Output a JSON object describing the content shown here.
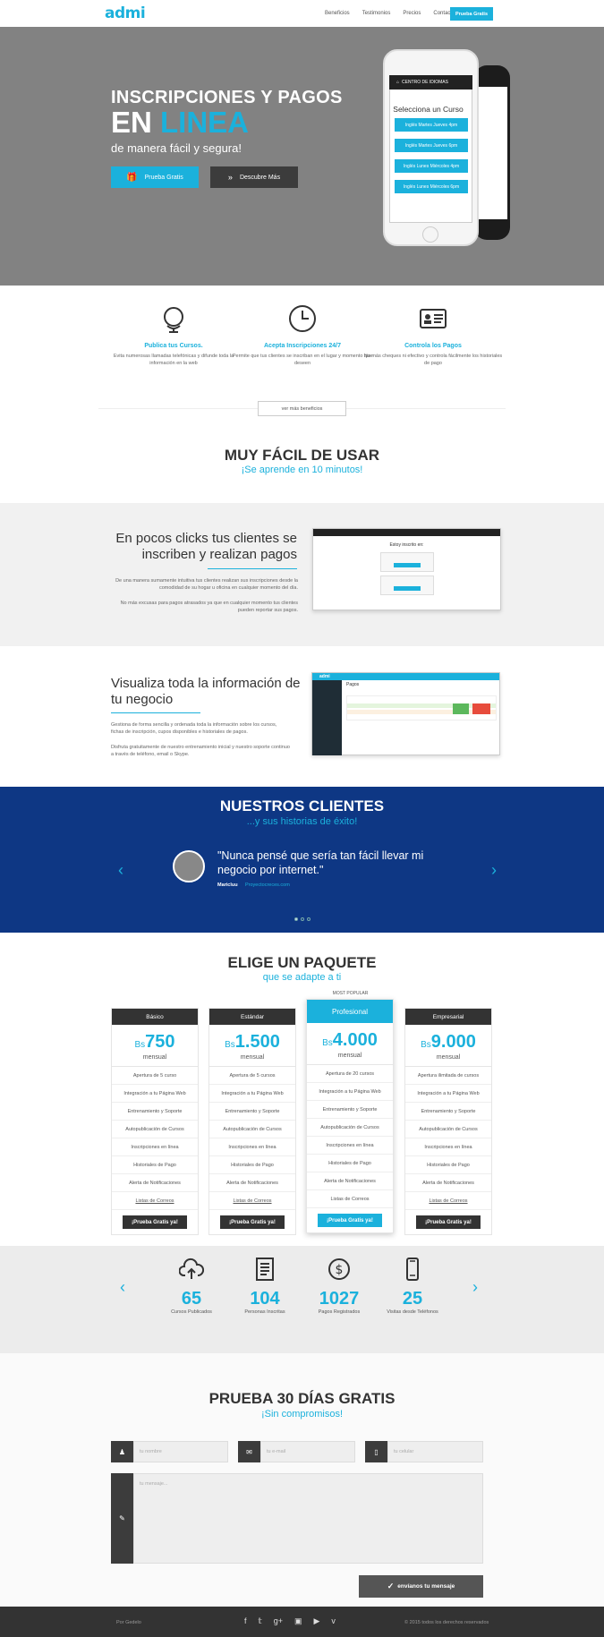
{
  "nav": {
    "logo": "admi",
    "links": [
      "Beneficios",
      "Testimonios",
      "Precios",
      "Contacto"
    ],
    "cta": "Prueba Gratis"
  },
  "hero": {
    "title_line1": "INSCRIPCIONES Y PAGOS",
    "title_line2_a": "EN ",
    "title_line2_b": "LINEA",
    "subtitle": "de manera fácil y segura!",
    "btn_primary": "Prueba Gratis",
    "btn_secondary": "Descubre Más",
    "phone": {
      "app_bar": "CENTRO DE IDIOMAS",
      "screen_title": "Selecciona un Curso",
      "courses": [
        "Inglés Martes Jueves 4pm",
        "Inglés Martes Jueves 6pm",
        "Inglés Lunes Miércoles 4pm",
        "Inglés Lunes Miércoles 6pm"
      ]
    }
  },
  "features": [
    {
      "icon": "globe-icon",
      "title": "Publica tus Cursos.",
      "desc": "Evita numerosas llamadas telefónicas y difunde toda la información en la web"
    },
    {
      "icon": "clock-icon",
      "title": "Acepta Inscripciones 24/7",
      "desc": "Permite que tus clientes se inscriban en el lugar y momento que deseen"
    },
    {
      "icon": "id-card-icon",
      "title": "Controla los Pagos",
      "desc": "No más cheques ni efectivo y controla fácilmente los historiales de pago"
    }
  ],
  "more_benefits": "ver más beneficios",
  "easy": {
    "title": "MUY FÁCIL DE USAR",
    "subtitle": "¡Se aprende en 10 minutos!"
  },
  "block1": {
    "title": "En pocos clicks tus clientes se inscriben y realizan pagos",
    "p1": "De una manera sumamente intuitiva tus clientes realizan sus inscripciones desde la comodidad de su hogar u oficina en cualquier momento del día.",
    "p2": "No más excusas para pagos atrasados ya que en cualquier momento tus clientes pueden reportar sus pagos.",
    "mock_title": "Estoy inscrito en:"
  },
  "block2": {
    "title": "Visualiza toda la información de tu negocio",
    "p1": "Gestiona de forma sencilla y ordenada toda la información sobre los cursos, fichas de inscripción, cupos disponibles e historiales de pagos.",
    "p2": "Disfruta gratuitamente de nuestro entrenamiento inicial y nuestro soporte continuo a través de teléfono, email o Skype.",
    "mock_logo": "admi",
    "mock_header": "Pagos"
  },
  "clients": {
    "title": "NUESTROS CLIENTES",
    "subtitle": "...y sus historias de éxito!",
    "quote": "\"Nunca pensé que sería tan fácil llevar mi negocio por internet.\"",
    "author": "Maricluu",
    "company": "Proyectocreces.com"
  },
  "pricing": {
    "title": "ELIGE UN PAQUETE",
    "subtitle": "que se adapte a ti",
    "popular": "MOST POPULAR",
    "currency": "Bs",
    "period": "mensual",
    "plans": [
      {
        "name": "Básico",
        "price": "750",
        "items": [
          "Apertura de 5 curso",
          "Integración a tu Página Web",
          "Entrenamiento y Soporte",
          "Autopublicación de Cursos",
          "Inscripciones en línea",
          "Historiales de Pago",
          "Alerta de Notificaciones",
          "Listas de Correos"
        ],
        "cta": "¡Prueba Gratis ya!"
      },
      {
        "name": "Estándar",
        "price": "1.500",
        "items": [
          "Apertura de 5 cursos",
          "Integración a tu Página Web",
          "Entrenamiento y Soporte",
          "Autopublicación de Cursos",
          "Inscripciones en línea",
          "Historiales de Pago",
          "Alerta de Notificaciones",
          "Listas de Correos"
        ],
        "cta": "¡Prueba Gratis ya!"
      },
      {
        "name": "Profesional",
        "price": "4.000",
        "items": [
          "Apertura de 20 cursos",
          "Integración a tu Página Web",
          "Entrenamiento y Soporte",
          "Autopublicación de Cursos",
          "Inscripciones en línea",
          "Historiales de Pago",
          "Alerta de Notificaciones",
          "Listas de Correos"
        ],
        "cta": "¡Prueba Gratis ya!"
      },
      {
        "name": "Empresarial",
        "price": "9.000",
        "items": [
          "Apertura ilimitada de cursos",
          "Integración a tu Página Web",
          "Entrenamiento y Soporte",
          "Autopublicación de Cursos",
          "Inscripciones en línea",
          "Historiales de Pago",
          "Alerta de Notificaciones",
          "Listas de Correos"
        ],
        "cta": "¡Prueba Gratis ya!"
      }
    ]
  },
  "stats": [
    {
      "icon": "cloud-upload-icon",
      "number": "65",
      "label": "Cursos Publicados"
    },
    {
      "icon": "document-icon",
      "number": "104",
      "label": "Personas Inscritas"
    },
    {
      "icon": "dollar-icon",
      "number": "1027",
      "label": "Pagos Registrados"
    },
    {
      "icon": "phone-icon",
      "number": "25",
      "label": "Visitas desde Teléfonos"
    }
  ],
  "trial": {
    "title": "PRUEBA 30 DÍAS GRATIS",
    "subtitle": "¡Sin compromisos!",
    "name_placeholder": "tu nombre",
    "email_placeholder": "tu e-mail",
    "phone_placeholder": "tu celular",
    "message_placeholder": "tu mensaje...",
    "send": "envíanos tu mensaje"
  },
  "footer": {
    "left": "Por Gedelo",
    "right": "© 2015 todos los derechos reservados"
  }
}
